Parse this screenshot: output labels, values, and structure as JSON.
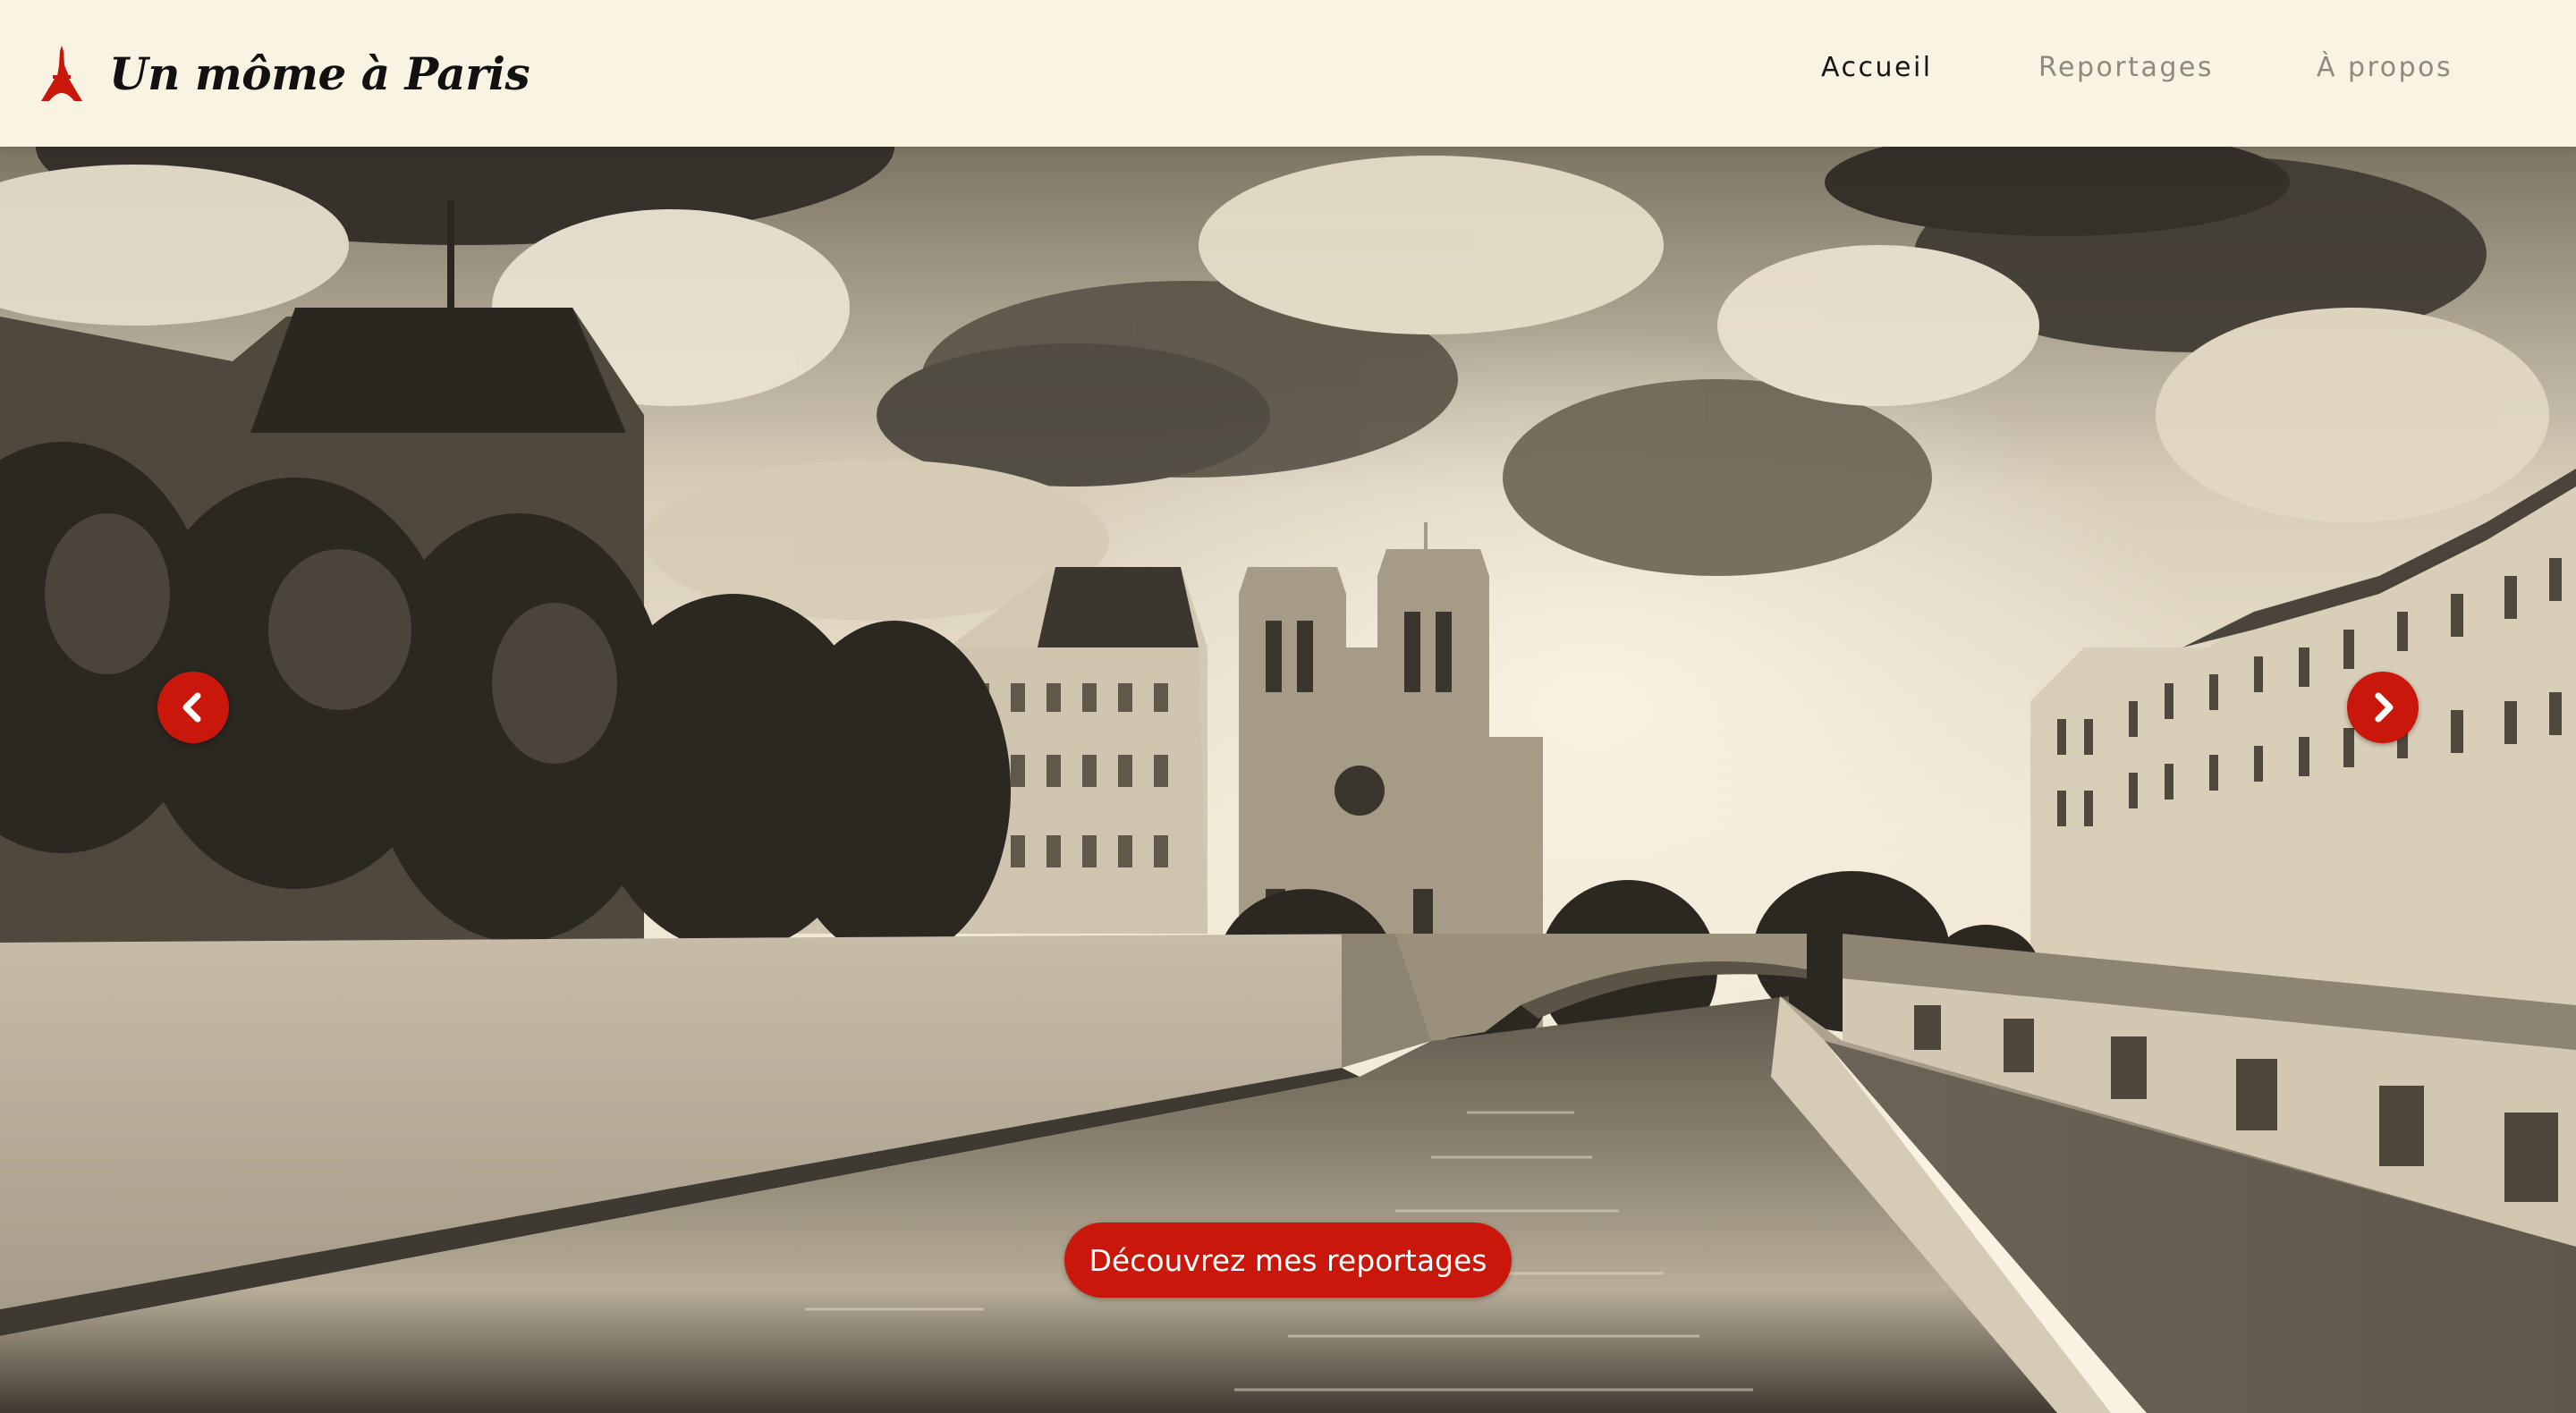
{
  "site": {
    "title": "Un môme à Paris",
    "logo_icon": "eiffel-tower-icon"
  },
  "nav": {
    "items": [
      {
        "label": "Accueil",
        "active": true
      },
      {
        "label": "Reportages",
        "active": false
      },
      {
        "label": "À propos",
        "active": false
      }
    ]
  },
  "hero": {
    "image_subject": "notre-dame-seine-photo",
    "cta_label": "Découvrez mes reportages",
    "prev_icon": "chevron-left-icon",
    "next_icon": "chevron-right-icon"
  },
  "colors": {
    "accent": "#c9170c",
    "header_bg": "#f9f3e3",
    "nav_active": "#161616",
    "nav_inactive": "#8e8a80"
  }
}
